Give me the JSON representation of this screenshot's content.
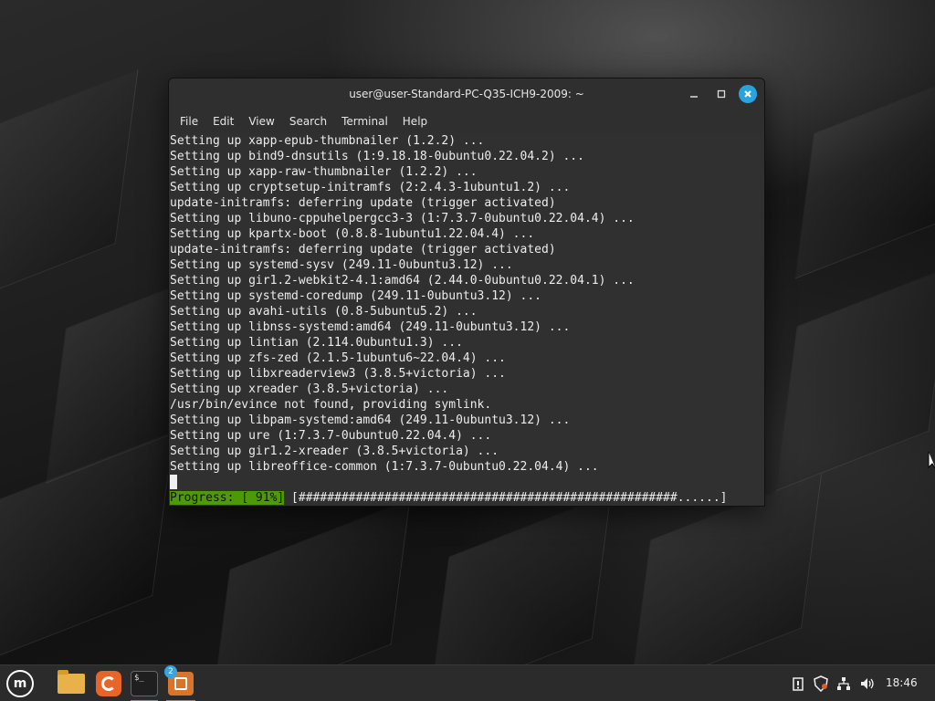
{
  "window": {
    "title": "user@user-Standard-PC-Q35-ICH9-2009: ~"
  },
  "menu": [
    "File",
    "Edit",
    "View",
    "Search",
    "Terminal",
    "Help"
  ],
  "terminal": {
    "lines": [
      "Setting up xapp-epub-thumbnailer (1.2.2) ...",
      "Setting up bind9-dnsutils (1:9.18.18-0ubuntu0.22.04.2) ...",
      "Setting up xapp-raw-thumbnailer (1.2.2) ...",
      "Setting up cryptsetup-initramfs (2:2.4.3-1ubuntu1.2) ...",
      "update-initramfs: deferring update (trigger activated)",
      "Setting up libuno-cppuhelpergcc3-3 (1:7.3.7-0ubuntu0.22.04.4) ...",
      "Setting up kpartx-boot (0.8.8-1ubuntu1.22.04.4) ...",
      "update-initramfs: deferring update (trigger activated)",
      "Setting up systemd-sysv (249.11-0ubuntu3.12) ...",
      "Setting up gir1.2-webkit2-4.1:amd64 (2.44.0-0ubuntu0.22.04.1) ...",
      "Setting up systemd-coredump (249.11-0ubuntu3.12) ...",
      "Setting up avahi-utils (0.8-5ubuntu5.2) ...",
      "Setting up libnss-systemd:amd64 (249.11-0ubuntu3.12) ...",
      "Setting up lintian (2.114.0ubuntu1.3) ...",
      "Setting up zfs-zed (2.1.5-1ubuntu6~22.04.4) ...",
      "Setting up libxreaderview3 (3.8.5+victoria) ...",
      "Setting up xreader (3.8.5+victoria) ...",
      "/usr/bin/evince not found, providing symlink.",
      "Setting up libpam-systemd:amd64 (249.11-0ubuntu3.12) ...",
      "Setting up ure (1:7.3.7-0ubuntu0.22.04.4) ...",
      "Setting up gir1.2-xreader (3.8.5+victoria) ...",
      "Setting up libreoffice-common (1:7.3.7-0ubuntu0.22.04.4) ..."
    ],
    "progress_label": "Progress: [ 91%]",
    "progress_bar": " [#####################################################......]",
    "progress_percent": 91
  },
  "taskbar": {
    "badge_count": "2",
    "clock": "18:46"
  },
  "colors": {
    "progress_label_bg": "#4e9a06",
    "accent": "#35a4e4",
    "close_button": "#29a3e0"
  }
}
